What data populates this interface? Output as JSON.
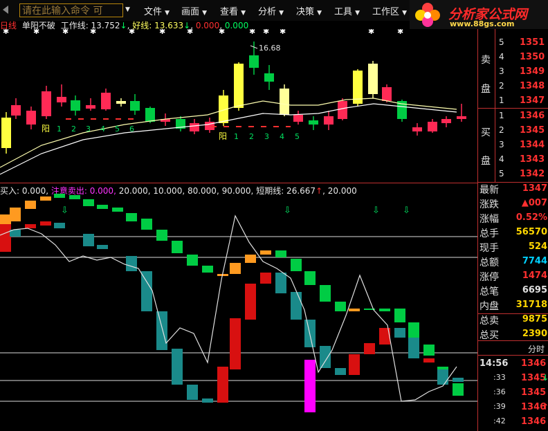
{
  "menubar": {
    "command_placeholder": "请在此输入命令",
    "command_suffix": "可",
    "items": [
      "文件",
      "画面",
      "查看",
      "分析",
      "决策",
      "工具",
      "工作区"
    ]
  },
  "logo": {
    "name": "分析家公式网",
    "url": "www.88gs.com"
  },
  "main_info": {
    "period": "日线",
    "title": "单阳不破",
    "work_line_label": "工作线: 13.752",
    "good_line_label": "好线: 13.633",
    "v3": "0.000",
    "v4": "0.000",
    "high_label": "16.68",
    "yang1": "阳",
    "yang2": "阳",
    "count1": [
      "1",
      "2",
      "3",
      "4",
      "5",
      "6"
    ],
    "count2": [
      "1",
      "2",
      "3",
      "4",
      "5"
    ]
  },
  "sub_info": {
    "buy_label": "买入: 0.000,",
    "sell_label": "注意卖出: 0.000,",
    "values": "20.000, 10.000, 80.000, 90.000,",
    "short_label": "短期线: 26.667",
    "last_value": "20.000"
  },
  "order_book": {
    "sell_label_1": "卖",
    "sell_label_2": "盘",
    "buy_label_1": "买",
    "buy_label_2": "盘",
    "sell": [
      {
        "level": "5",
        "price": "1351"
      },
      {
        "level": "4",
        "price": "1350"
      },
      {
        "level": "3",
        "price": "1349"
      },
      {
        "level": "2",
        "price": "1348"
      },
      {
        "level": "1",
        "price": "1347"
      }
    ],
    "buy": [
      {
        "level": "1",
        "price": "1346"
      },
      {
        "level": "2",
        "price": "1345"
      },
      {
        "level": "3",
        "price": "1344"
      },
      {
        "level": "4",
        "price": "1343"
      },
      {
        "level": "5",
        "price": "1342"
      }
    ]
  },
  "quote": [
    {
      "label": "最新",
      "value": "1347",
      "color": "#ff3030"
    },
    {
      "label": "涨跌",
      "value": "▲007",
      "color": "#ff3030"
    },
    {
      "label": "涨幅",
      "value": "0.52%",
      "color": "#ff3030"
    },
    {
      "label": "总手",
      "value": "56570",
      "color": "#ffd700"
    },
    {
      "label": "现手",
      "value": "524",
      "color": "#ffd700"
    },
    {
      "label": "总额",
      "value": "7744",
      "color": "#00d0ff"
    },
    {
      "label": "涨停",
      "value": "1474",
      "color": "#ff3030"
    },
    {
      "label": "总笔",
      "value": "6695",
      "color": "#e0e0e0"
    },
    {
      "label": "内盘",
      "value": "31718",
      "color": "#ffd700"
    },
    {
      "label": "总卖",
      "value": "9875",
      "color": "#ffd700"
    },
    {
      "label": "总买",
      "value": "2390",
      "color": "#ffd700"
    }
  ],
  "ticks": {
    "header": "分时",
    "rows": [
      {
        "time": "14:56",
        "price": "1346",
        "arrow": ""
      },
      {
        "time": ":33",
        "price": "1345",
        "arrow": "↓"
      },
      {
        "time": ":36",
        "price": "1345",
        "arrow": ""
      },
      {
        "time": ":39",
        "price": "1346",
        "arrow": "↑"
      },
      {
        "time": ":42",
        "price": "1346",
        "arrow": ""
      }
    ]
  },
  "colors": {
    "up": "#ff2a55",
    "down": "#00cc44",
    "yellow": "#ffff40",
    "lightyellow": "#ffff99",
    "teal": "#1a8a8a",
    "orange": "#ff9a20",
    "magenta": "#ff00ff",
    "red": "#d81010",
    "green": "#10c030"
  }
}
